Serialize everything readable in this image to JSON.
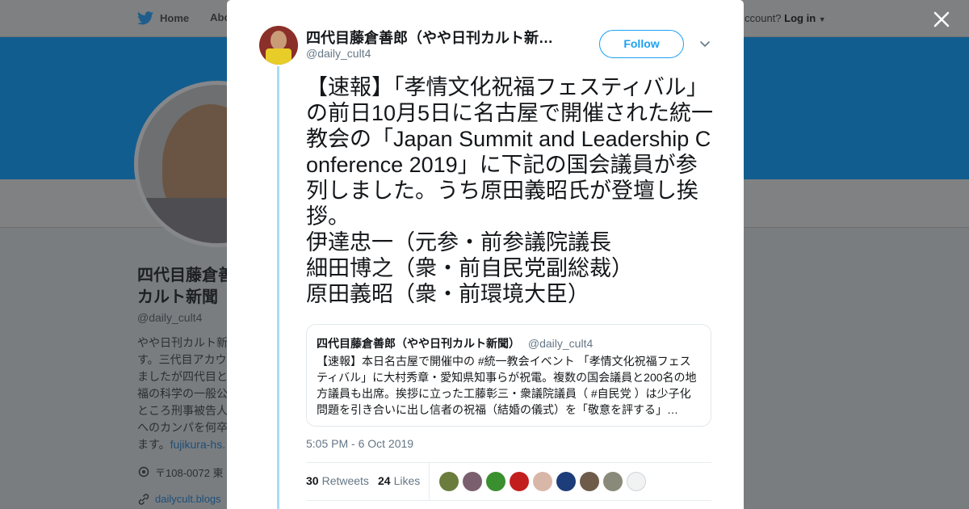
{
  "background": {
    "nav": {
      "home": "Home",
      "about": "Abo"
    },
    "right_text": "ccount?",
    "login": "Log in",
    "profile_name": "四代目藤倉善郎（やや日刊カルト新聞",
    "profile_name_line1": "四代目藤倉善",
    "profile_name_line2": "カルト新聞",
    "profile_handle": "@daily_cult4",
    "bio_lines": [
      "やや日刊カルト新",
      "す。三代目アカウ",
      "ましたが四代目と",
      "福の科学の一般公",
      "ところ刑事被告人",
      "へのカンパを何卒",
      "ます。"
    ],
    "bio_link": "fujikura-hs.",
    "location": "〒108-0072 東",
    "website": "dailycult.blogs"
  },
  "tweet": {
    "author_name": "四代目藤倉善郎（やや日刊カルト新…",
    "author_handle": "@daily_cult4",
    "follow_label": "Follow",
    "text": "【速報】「孝情文化祝福フェスティバル」の前日10月5日に名古屋で開催された統一教会の「Japan Summit and Leadership Conference 2019」に下記の国会議員が参列しました。うち原田義昭氏が登壇し挨拶。\n伊達忠一（元参・前参議院議長\n細田博之（衆・前自民党副総裁）\n原田義昭（衆・前環境大臣）",
    "quote": {
      "name": "四代目藤倉善郎（やや日刊カルト新聞）",
      "handle": "@daily_cult4",
      "text": "【速報】本日名古屋で開催中の #統一教会イベント 「孝情文化祝福フェスティバル」に大村秀章・愛知県知事らが祝電。複数の国会議員と200名の地方議員も出席。挨拶に立った工藤彰三・衆議院議員（ #自民党 ）は少子化問題を引き合いに出し信者の祝福（結婚の儀式）を「敬意を評する」…"
    },
    "timestamp": "5:05 PM - 6 Oct 2019",
    "retweets_count": "30",
    "retweets_label": "Retweets",
    "likes_count": "24",
    "likes_label": "Likes",
    "liker_colors": [
      "#6b7d3d",
      "#7a5f6e",
      "#3a8f2e",
      "#c21e1e",
      "#d9b7a8",
      "#1d3d7a",
      "#6e5b4a",
      "#8a8a7a",
      "#f2f2f2"
    ]
  },
  "colors": {
    "accent": "#1da1f2",
    "thread_line": "#a9dcf7",
    "banner": "#125d8f"
  }
}
